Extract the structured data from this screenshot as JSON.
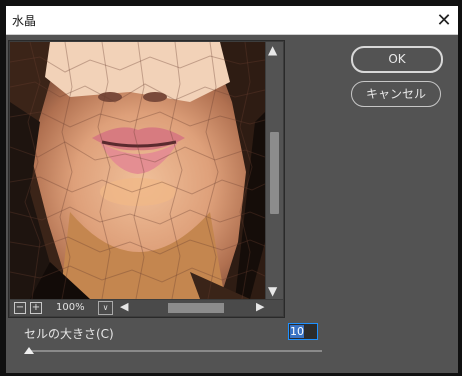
{
  "window": {
    "title": "水晶",
    "close_glyph": "✕"
  },
  "buttons": {
    "ok_label": "OK",
    "cancel_label": "キャンセル"
  },
  "preview": {
    "zoom_out_glyph": "−",
    "zoom_in_glyph": "+",
    "zoom_level": "100%",
    "zoom_dropdown_glyph": "∨",
    "scroll_up_glyph": "▲",
    "scroll_down_glyph": "▼",
    "scroll_left_glyph": "◀",
    "scroll_right_glyph": "▶"
  },
  "cell_size": {
    "label": "セルの大きさ(C)",
    "value": "10"
  },
  "colors": {
    "panel_bg": "#535353",
    "accent": "#1e90ff",
    "titlebar_bg": "#ffffff"
  }
}
